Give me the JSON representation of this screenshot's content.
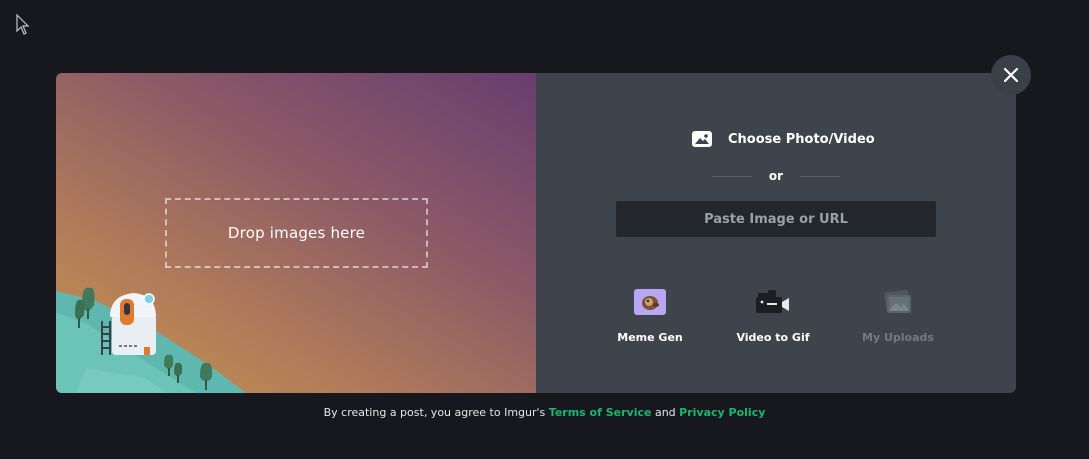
{
  "modal": {
    "dropzone_label": "Drop images here",
    "choose_label": "Choose Photo/Video",
    "or_label": "or",
    "paste_placeholder": "Paste Image or URL",
    "options": [
      {
        "label": "Meme Gen",
        "icon": "meme-gen-icon",
        "enabled": true
      },
      {
        "label": "Video to Gif",
        "icon": "video-camera-icon",
        "enabled": true
      },
      {
        "label": "My Uploads",
        "icon": "my-uploads-icon",
        "enabled": false
      }
    ]
  },
  "footer": {
    "prefix": "By creating a post, you agree to Imgur's",
    "terms": "Terms of Service",
    "and": "and",
    "privacy": "Privacy Policy"
  },
  "colors": {
    "background": "#17181d",
    "panel": "#3e434c",
    "link": "#1bb76e",
    "input_bg": "#24262d"
  }
}
